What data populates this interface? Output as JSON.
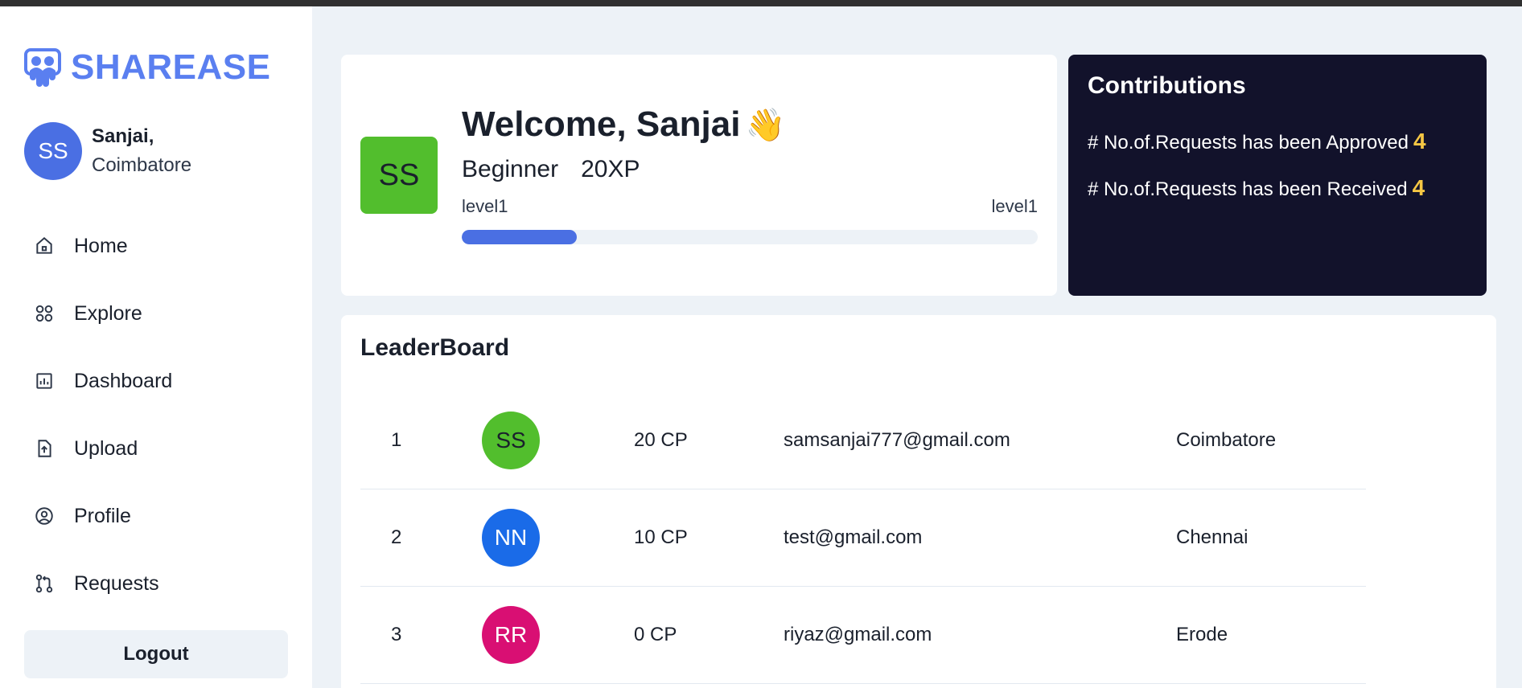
{
  "app": {
    "brand": "SHAREASE"
  },
  "user": {
    "initials": "SS",
    "name": "Sanjai,",
    "city": "Coimbatore"
  },
  "nav": [
    {
      "label": "Home",
      "icon": "home-icon"
    },
    {
      "label": "Explore",
      "icon": "explore-icon"
    },
    {
      "label": "Dashboard",
      "icon": "dashboard-icon"
    },
    {
      "label": "Upload",
      "icon": "upload-icon"
    },
    {
      "label": "Profile",
      "icon": "profile-icon"
    },
    {
      "label": "Requests",
      "icon": "requests-icon"
    }
  ],
  "logout_label": "Logout",
  "welcome": {
    "title": "Welcome, Sanjai",
    "emoji": "👋",
    "initials": "SS",
    "rank": "Beginner",
    "xp": "20XP",
    "level_left": "level1",
    "level_right": "level1",
    "progress_percent": 20
  },
  "contributions": {
    "title": "Contributions",
    "approved_label": "# No.of.Requests has been Approved",
    "approved_count": "4",
    "received_label": "# No.of.Requests has been Received",
    "received_count": "4"
  },
  "leaderboard": {
    "title": "LeaderBoard",
    "rows": [
      {
        "rank": "1",
        "initials": "SS",
        "avatar_color": "#52be2d",
        "avatar_text_color": "#1a202c",
        "points": "20 CP",
        "email": "samsanjai777@gmail.com",
        "city": "Coimbatore"
      },
      {
        "rank": "2",
        "initials": "NN",
        "avatar_color": "#1a6be8",
        "avatar_text_color": "#ffffff",
        "points": "10 CP",
        "email": "test@gmail.com",
        "city": "Chennai"
      },
      {
        "rank": "3",
        "initials": "RR",
        "avatar_color": "#d90f73",
        "avatar_text_color": "#ffffff",
        "points": "0 CP",
        "email": "riyaz@gmail.com",
        "city": "Erode"
      }
    ]
  },
  "colors": {
    "brand": "#5a7ff0",
    "accent": "#4a6fe3",
    "dark_card": "#12122b",
    "highlight": "#f6c744"
  }
}
